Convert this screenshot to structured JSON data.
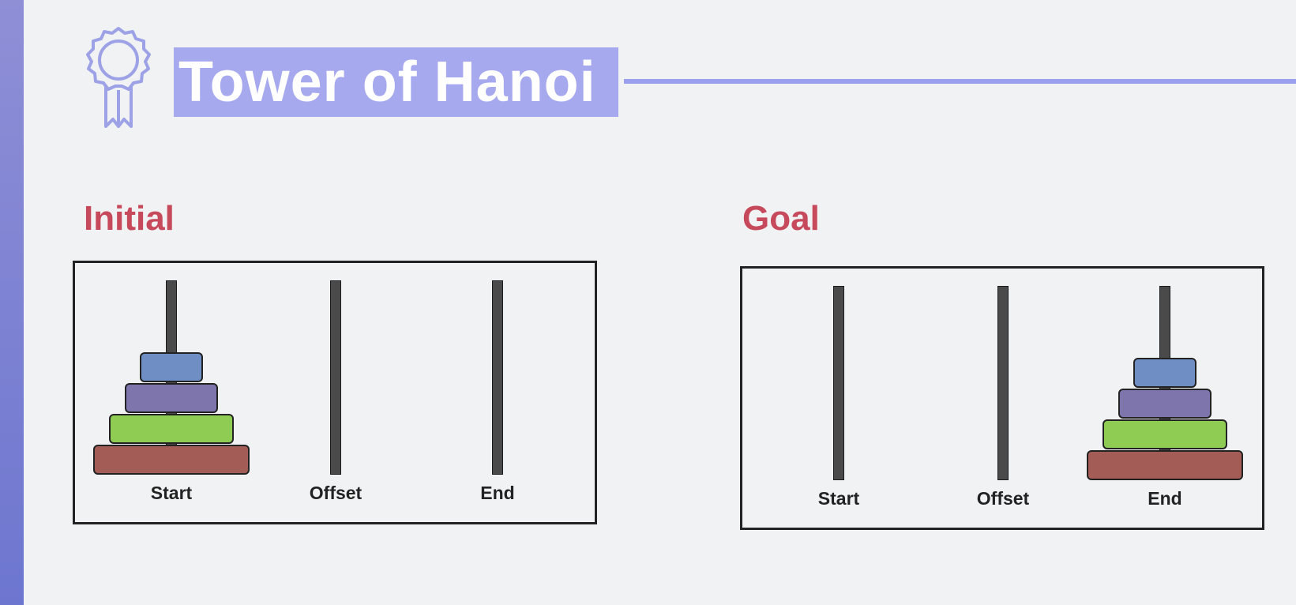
{
  "title": "Tower of Hanoi",
  "colors": {
    "title_bg": "#a7a9ee",
    "title_rule": "#9aa0ee",
    "section_label": "#c64a5c",
    "disk_small": "#6f8fc4",
    "disk_medium": "#7e75ad",
    "disk_large": "#8ecc53",
    "disk_largest": "#a45d56"
  },
  "initial": {
    "label": "Initial",
    "pegs": [
      {
        "label": "Start",
        "disks": [
          "largest",
          "large",
          "medium",
          "small"
        ]
      },
      {
        "label": "Offset",
        "disks": []
      },
      {
        "label": "End",
        "disks": []
      }
    ]
  },
  "goal": {
    "label": "Goal",
    "pegs": [
      {
        "label": "Start",
        "disks": []
      },
      {
        "label": "Offset",
        "disks": []
      },
      {
        "label": "End",
        "disks": [
          "largest",
          "large",
          "medium",
          "small"
        ]
      }
    ]
  }
}
